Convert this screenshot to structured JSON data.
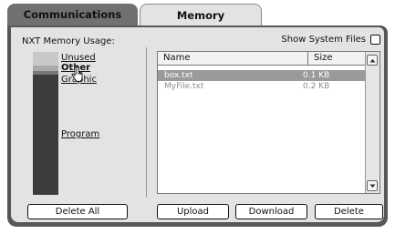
{
  "tabs": [
    {
      "label": "Communications",
      "active": false
    },
    {
      "label": "Memory",
      "active": true
    }
  ],
  "memory": {
    "title": "NXT Memory Usage:",
    "categories": [
      "Unused",
      "Other",
      "Graphic",
      "Program"
    ],
    "hovered": "Other"
  },
  "options": {
    "show_system_files_label": "Show System Files",
    "show_system_files_checked": false
  },
  "file_list": {
    "columns": [
      "Name",
      "Size"
    ],
    "rows": [
      {
        "name": "box.txt",
        "size": "0.1 KB",
        "selected": true
      },
      {
        "name": "MyFile.txt",
        "size": "0.2 KB",
        "selected": false
      }
    ]
  },
  "buttons": {
    "delete_all": "Delete All",
    "upload": "Upload",
    "download": "Download",
    "delete": "Delete"
  },
  "icons": [
    "hand-cursor-icon",
    "scroll-up-arrow-icon",
    "scroll-down-arrow-icon"
  ],
  "colors": {
    "frame": "#575757",
    "panel": "#e3e3e3",
    "selected_row": "#9a9a9a"
  }
}
